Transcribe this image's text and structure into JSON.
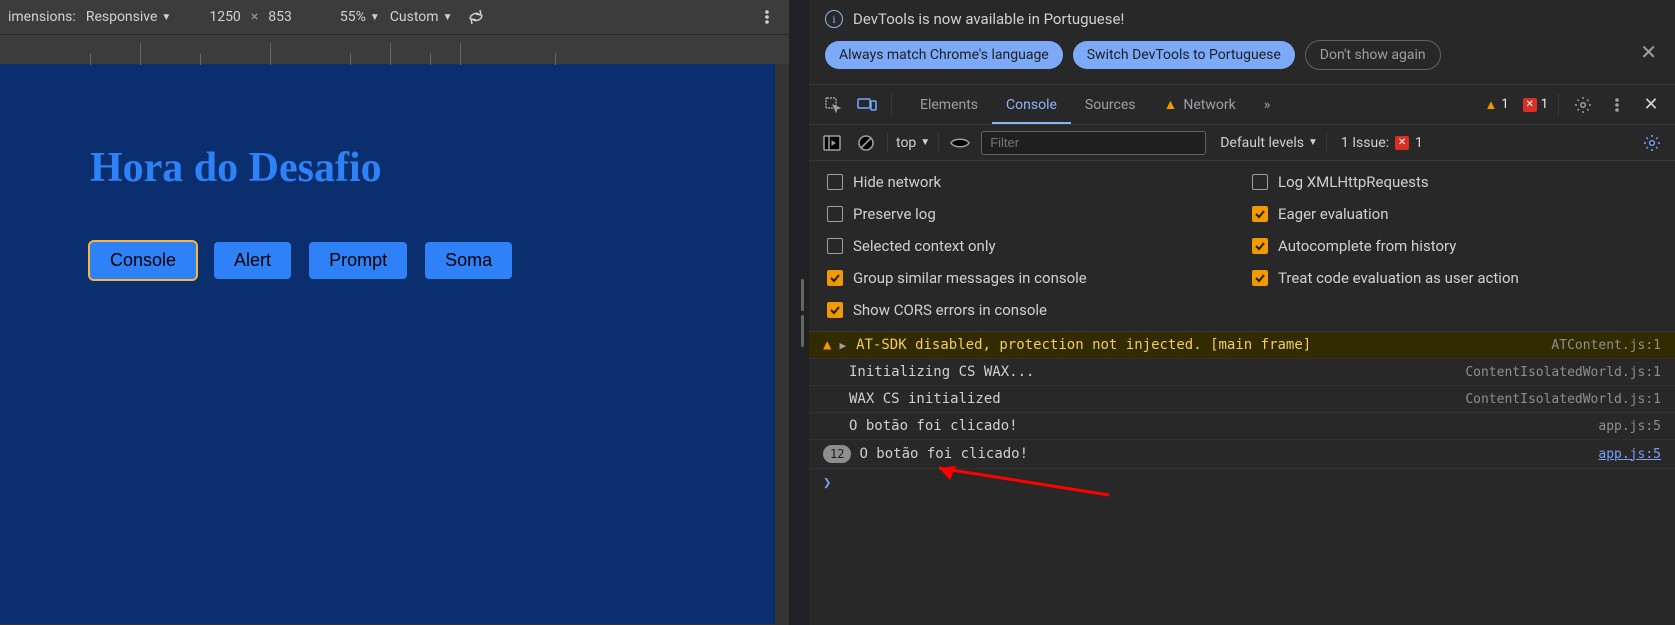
{
  "device_toolbar": {
    "dimensions_label": "imensions:",
    "mode": "Responsive",
    "width": "1250",
    "height": "853",
    "separator": "×",
    "zoom": "55%",
    "throttle": "Custom"
  },
  "page": {
    "title": "Hora do Desafio",
    "buttons": [
      "Console",
      "Alert",
      "Prompt",
      "Soma"
    ]
  },
  "devtools": {
    "banner": {
      "message": "DevTools is now available in Portuguese!",
      "btn_match": "Always match Chrome's language",
      "btn_switch": "Switch DevTools to Portuguese",
      "btn_dont": "Don't show again"
    },
    "tabs": {
      "elements": "Elements",
      "console": "Console",
      "sources": "Sources",
      "network": "Network",
      "more": "»",
      "warn_count": "1",
      "err_count": "1"
    },
    "console_toolbar": {
      "context": "top",
      "filter_placeholder": "Filter",
      "levels": "Default levels",
      "issues_label": "1 Issue:",
      "issues_count": "1"
    },
    "settings": {
      "hide_network": "Hide network",
      "log_xhr": "Log XMLHttpRequests",
      "preserve_log": "Preserve log",
      "eager_eval": "Eager evaluation",
      "selected_ctx": "Selected context only",
      "autocomplete": "Autocomplete from history",
      "group_similar": "Group similar messages in console",
      "treat_code": "Treat code evaluation as user action",
      "show_cors": "Show CORS errors in console"
    },
    "messages": {
      "warn_text": "AT-SDK disabled, protection not injected. [main frame]",
      "warn_src": "ATContent.js:1",
      "m1_text": "Initializing CS WAX...",
      "m1_src": "ContentIsolatedWorld.js:1",
      "m2_text": "WAX CS initialized",
      "m2_src": "ContentIsolatedWorld.js:1",
      "m3_text": "O botão foi clicado!",
      "m3_src": "app.js:5",
      "m4_count": "12",
      "m4_text": "O botão foi clicado!",
      "m4_src": "app.js:5"
    }
  }
}
